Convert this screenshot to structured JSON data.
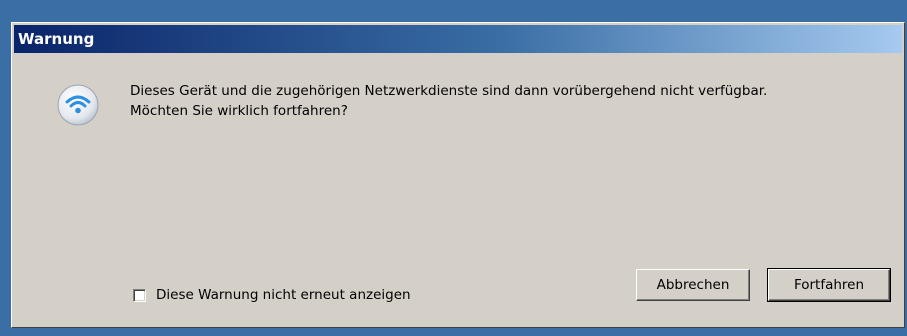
{
  "dialog": {
    "title": "Warnung",
    "message": "Dieses Gerät und die zugehörigen Netzwerkdienste sind dann vorübergehend nicht verfügbar.\nMöchten Sie wirklich fortfahren?",
    "icon": "wifi-icon",
    "checkbox_label": "Diese Warnung nicht erneut anzeigen",
    "checkbox_checked": false,
    "cancel_label": "Abbrechen",
    "continue_label": "Fortfahren"
  },
  "colors": {
    "face": "#d4d0c8",
    "title_start": "#0a246a",
    "title_end": "#a6caf0",
    "desktop": "#3a6ea5"
  }
}
